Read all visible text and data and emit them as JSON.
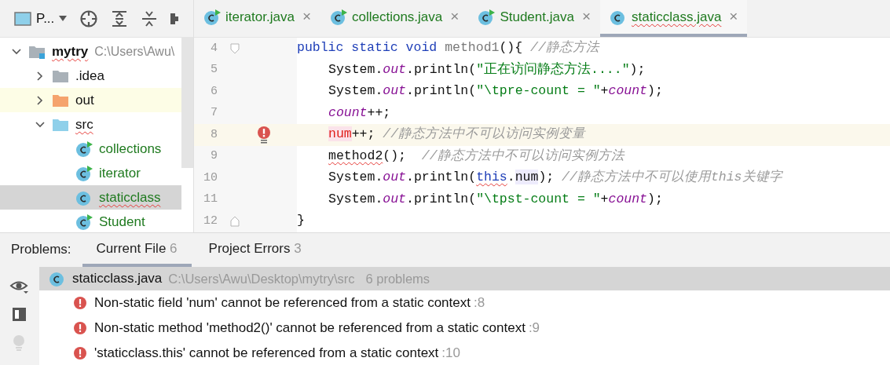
{
  "project_toolbar": {
    "view_label": "P..."
  },
  "project_tree": [
    {
      "label": "mytry",
      "kind": "module",
      "path": "C:\\Users\\Awu\\",
      "expanded": true,
      "selected": false,
      "highlighted": false,
      "error": true,
      "children": [
        {
          "label": ".idea",
          "kind": "folder",
          "expanded": false,
          "selected": false,
          "highlighted": false,
          "error": false
        },
        {
          "label": "out",
          "kind": "excluded",
          "expanded": false,
          "selected": false,
          "highlighted": true,
          "error": false
        },
        {
          "label": "src",
          "kind": "source",
          "expanded": true,
          "selected": false,
          "highlighted": false,
          "error": true,
          "children": [
            {
              "label": "collections",
              "kind": "class",
              "selected": false,
              "highlighted": false,
              "error": false,
              "runnable": true
            },
            {
              "label": "iterator",
              "kind": "class",
              "selected": false,
              "highlighted": false,
              "error": false,
              "runnable": true
            },
            {
              "label": "staticclass",
              "kind": "class",
              "selected": true,
              "highlighted": false,
              "error": true,
              "runnable": false
            },
            {
              "label": "Student",
              "kind": "class",
              "selected": false,
              "highlighted": false,
              "error": false,
              "runnable": true
            }
          ]
        }
      ]
    }
  ],
  "editor_tabs": [
    {
      "label": "iterator.java",
      "selected": false,
      "error": false,
      "runnable": true,
      "close": "×"
    },
    {
      "label": "collections.java",
      "selected": false,
      "error": false,
      "runnable": true,
      "close": "×"
    },
    {
      "label": "Student.java",
      "selected": false,
      "error": false,
      "runnable": true,
      "close": "×"
    },
    {
      "label": "staticclass.java",
      "selected": true,
      "error": true,
      "runnable": false,
      "close": "×"
    }
  ],
  "code_lines": [
    {
      "number": "4",
      "foldable": true,
      "error_marker": false,
      "highlighted": false,
      "tokens": [
        {
          "kind": "keyword",
          "text": "public static void "
        },
        {
          "kind": "unused",
          "text": "method1"
        },
        {
          "kind": "plain",
          "text": "(){ "
        },
        {
          "kind": "comment",
          "text": "//静态方法"
        }
      ],
      "children": [
        {
          "number": "5",
          "foldable": false,
          "error_marker": false,
          "highlighted": false,
          "tokens": [
            {
              "kind": "plain",
              "text": "System."
            },
            {
              "kind": "field",
              "text": "out"
            },
            {
              "kind": "plain",
              "text": ".println("
            },
            {
              "kind": "string",
              "text": "\"正在访问静态方法....\""
            },
            {
              "kind": "plain",
              "text": ");"
            }
          ]
        },
        {
          "number": "6",
          "foldable": false,
          "error_marker": false,
          "highlighted": false,
          "tokens": [
            {
              "kind": "plain",
              "text": "System."
            },
            {
              "kind": "field",
              "text": "out"
            },
            {
              "kind": "plain",
              "text": ".println("
            },
            {
              "kind": "string",
              "text": "\"\\tpre-count = \""
            },
            {
              "kind": "plain",
              "text": "+"
            },
            {
              "kind": "field",
              "text": "count"
            },
            {
              "kind": "plain",
              "text": ");"
            }
          ]
        },
        {
          "number": "7",
          "foldable": false,
          "error_marker": false,
          "highlighted": false,
          "tokens": [
            {
              "kind": "field",
              "text": "count"
            },
            {
              "kind": "plain",
              "text": "++;"
            }
          ]
        },
        {
          "number": "8",
          "foldable": false,
          "error_marker": true,
          "highlighted": true,
          "tokens": [
            {
              "kind": "error",
              "text": "num"
            },
            {
              "kind": "plain",
              "text": "++; "
            },
            {
              "kind": "comment",
              "text": "//静态方法中不可以访问实例变量"
            }
          ]
        },
        {
          "number": "9",
          "foldable": false,
          "error_marker": false,
          "highlighted": false,
          "tokens": [
            {
              "kind": "squiggle",
              "text": "method2"
            },
            {
              "kind": "plain",
              "text": "();  "
            },
            {
              "kind": "comment",
              "text": "//静态方法中不可以访问实例方法"
            }
          ]
        },
        {
          "number": "10",
          "foldable": false,
          "error_marker": false,
          "highlighted": false,
          "tokens": [
            {
              "kind": "plain",
              "text": "System."
            },
            {
              "kind": "field",
              "text": "out"
            },
            {
              "kind": "plain",
              "text": ".println("
            },
            {
              "kind": "keyword-squiggle",
              "text": "this"
            },
            {
              "kind": "plain",
              "text": "."
            },
            {
              "kind": "reference",
              "text": "num"
            },
            {
              "kind": "plain",
              "text": "); "
            },
            {
              "kind": "comment",
              "text": "//静态方法中不可以使用this关键字"
            }
          ]
        },
        {
          "number": "11",
          "foldable": false,
          "error_marker": false,
          "highlighted": false,
          "tokens": [
            {
              "kind": "plain",
              "text": "System."
            },
            {
              "kind": "field",
              "text": "out"
            },
            {
              "kind": "plain",
              "text": ".println("
            },
            {
              "kind": "string",
              "text": "\"\\tpst-count = \""
            },
            {
              "kind": "plain",
              "text": "+"
            },
            {
              "kind": "field",
              "text": "count"
            },
            {
              "kind": "plain",
              "text": ");"
            }
          ]
        }
      ]
    },
    {
      "number": "12",
      "foldable": true,
      "error_marker": false,
      "highlighted": false,
      "tokens": [
        {
          "kind": "plain",
          "text": "}"
        }
      ]
    }
  ],
  "problems": {
    "title": "Problems:",
    "tabs": [
      {
        "label": "Current File",
        "count": "6",
        "selected": true
      },
      {
        "label": "Project Errors",
        "count": "3",
        "selected": false
      }
    ],
    "file": {
      "name": "staticclass.java",
      "path": "C:\\Users\\Awu\\Desktop\\mytry\\src",
      "summary": "6 problems"
    },
    "items": [
      {
        "message": "Non-static field 'num' cannot be referenced from a static context",
        "line": ":8"
      },
      {
        "message": "Non-static method 'method2()' cannot be referenced from a static context",
        "line": ":9"
      },
      {
        "message": "'staticclass.this' cannot be referenced from a static context",
        "line": ":10"
      }
    ],
    "side_tools": [
      {
        "kind": "eye",
        "disabled": false
      },
      {
        "kind": "layout",
        "disabled": false
      },
      {
        "kind": "bulb",
        "disabled": true
      }
    ]
  }
}
